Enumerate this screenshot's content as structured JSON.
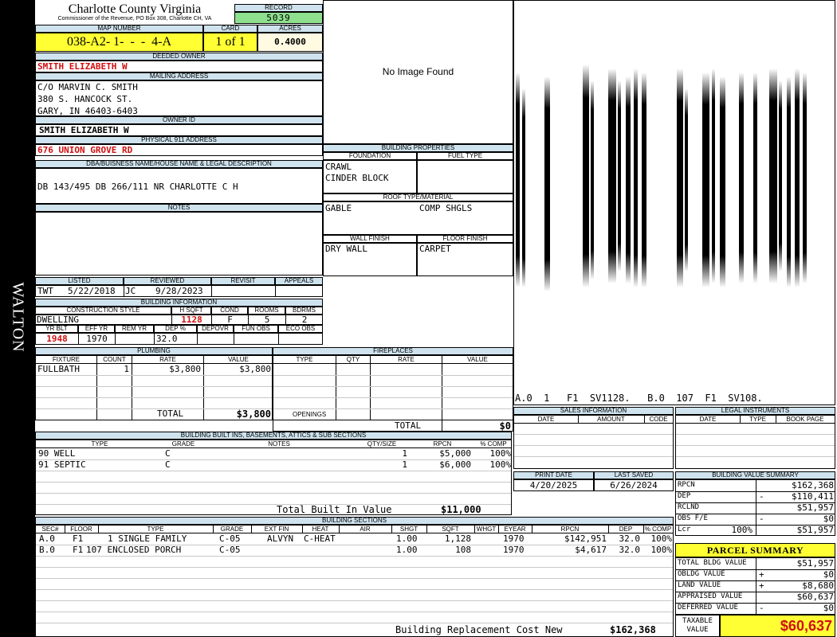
{
  "side_label": "WALTON",
  "header": {
    "county": "Charlotte County Virginia",
    "commissioner": "Commissioner of the Revenue, PO Box 308, Charlotte CH, VA",
    "record_label": "RECORD",
    "record": "5039",
    "map_number_label": "MAP NUMBER",
    "map_number": "038-A2- 1-  -  -  4-A",
    "card_label": "CARD",
    "card": "1 of 1",
    "acres_label": "ACRES",
    "acres": "0.4000"
  },
  "owner": {
    "deeded_owner_label": "DEEDED OWNER",
    "deeded_owner": "SMITH ELIZABETH W",
    "mailing_address_label": "MAILING ADDRESS",
    "mailing_line1": "C/O MARVIN C. SMITH",
    "mailing_line2": "380 S. HANCOCK ST.",
    "mailing_line3": "GARY, IN 46403-6403",
    "owner_id_label": "OWNER ID",
    "owner_id": "SMITH ELIZABETH W",
    "physical_label": "PHYSICAL 911 ADDRESS",
    "physical_address": "676 UNION GROVE RD",
    "legal_label": "DBA/BUISNESS NAME/HOUSE NAME & LEGAL DESCRIPTION",
    "legal_description": "DB 143/495 DB 266/111 NR CHARLOTTE C H",
    "notes_label": "NOTES"
  },
  "image": {
    "placeholder": "No Image Found"
  },
  "sketch": {
    "caption": "A.0  1   F1  SV1128.   B.0  107  F1  SV108."
  },
  "building_properties": {
    "title": "BUILDING PROPERTIES",
    "foundation_label": "FOUNDATION",
    "foundation_1": "CRAWL",
    "foundation_2": "CINDER BLOCK",
    "fuel_label": "FUEL TYPE",
    "fuel": "",
    "roof_label": "ROOF TYPE/MATERIAL",
    "roof_type": "GABLE",
    "roof_material": "COMP SHGLS",
    "wall_label": "WALL FINISH",
    "wall": "DRY WALL",
    "floor_label": "FLOOR FINISH",
    "floor": "CARPET"
  },
  "review": {
    "listed_label": "LISTED",
    "listed_by": "TWT",
    "listed_date": "5/22/2018",
    "reviewed_label": "REVIEWED",
    "reviewed_by": "JC",
    "reviewed_date": "9/28/2023",
    "revisit_label": "REVISIT",
    "appeals_label": "APPEALS"
  },
  "building_info": {
    "title": "BUILDING INFORMATION",
    "style_label": "CONSTRUCTION STYLE",
    "style": "DWELLING",
    "hsqft_label": "H SQFT",
    "hsqft": "1128",
    "cond_label": "COND",
    "cond": "F",
    "rooms_label": "ROOMS",
    "rooms": "5",
    "bdrms_label": "BDRMS",
    "bdrms": "2",
    "yrblt_label": "YR BLT",
    "yrblt": "1948",
    "effyr_label": "EFF YR",
    "effyr": "1970",
    "remyr_label": "REM YR",
    "remyr": "",
    "dep_label": "DEP %",
    "dep": "32.0",
    "depovr_label": "DEPOVR",
    "funobs_label": "FUN OBS",
    "ecoobs_label": "ECO OBS"
  },
  "plumbing": {
    "title": "PLUMBING",
    "headers": [
      "FIXTURE",
      "COUNT",
      "RATE",
      "VALUE"
    ],
    "rows": [
      [
        "FULLBATH",
        "1",
        "$3,800",
        "$3,800"
      ]
    ],
    "total_label": "TOTAL",
    "total": "$3,800"
  },
  "fireplaces": {
    "title": "FIREPLACES",
    "headers": [
      "TYPE",
      "QTY",
      "RATE",
      "VALUE"
    ],
    "openings_label": "OPENINGS",
    "total_label": "TOTAL",
    "total": "$0"
  },
  "built_ins": {
    "title": "BUILDING BUILT INS, BASEMENTS, ATTICS & SUB SECTIONS",
    "headers": [
      "TYPE",
      "GRADE",
      "NOTES",
      "QTY/SIZE",
      "RPCN",
      "% COMP"
    ],
    "rows": [
      [
        "90 WELL",
        "C",
        "",
        "1",
        "$5,000",
        "100%"
      ],
      [
        "91 SEPTIC",
        "C",
        "",
        "1",
        "$6,000",
        "100%"
      ]
    ],
    "total_label": "Total Built In Value",
    "total": "$11,000"
  },
  "sales": {
    "title": "SALES INFORMATION",
    "headers": [
      "DATE",
      "AMOUNT",
      "CODE"
    ]
  },
  "legal_instruments": {
    "title": "LEGAL INSTRUMENTS",
    "headers": [
      "DATE",
      "TYPE",
      "BOOK PAGE"
    ]
  },
  "dates": {
    "print_label": "PRINT DATE",
    "print_date": "4/20/2025",
    "saved_label": "LAST SAVED",
    "saved_date": "6/26/2024"
  },
  "value_summary": {
    "title": "BUILDING VALUE SUMMARY",
    "rows": [
      {
        "label": "RPCN",
        "pct": "",
        "sign": "",
        "value": "$162,368"
      },
      {
        "label": "DEP",
        "pct": "",
        "sign": "-",
        "value": "$110,411"
      },
      {
        "label": "RCLND",
        "pct": "",
        "sign": "",
        "value": "$51,957"
      },
      {
        "label": "OBS F/E",
        "pct": "",
        "sign": "-",
        "value": "$0"
      },
      {
        "label": "Lcr",
        "pct": "100%",
        "sign": "",
        "value": "$51,957"
      }
    ]
  },
  "parcel_summary": {
    "title": "PARCEL SUMMARY",
    "rows": [
      {
        "label": "TOTAL BLDG VALUE",
        "sign": "",
        "value": "$51,957"
      },
      {
        "label": "OBLDG VALUE",
        "sign": "+",
        "value": "$0"
      },
      {
        "label": "LAND VALUE",
        "sign": "+",
        "value": "$8,680"
      },
      {
        "label": "APPRAISED VALUE",
        "sign": "",
        "value": "$60,637"
      },
      {
        "label": "DEFERRED VALUE",
        "sign": "-",
        "value": "$0"
      }
    ],
    "taxable_label_1": "TAXABLE",
    "taxable_label_2": "VALUE",
    "taxable_value": "$60,637"
  },
  "sections": {
    "title": "BUILDING SECTIONS",
    "headers": [
      "SEC#",
      "FLOOR",
      "TYPE",
      "GRADE",
      "EXT FIN",
      "HEAT",
      "AIR",
      "SHGT",
      "SQFT",
      "WHGT",
      "EYEAR",
      "RPCN",
      "DEP",
      "% COMP"
    ],
    "rows": [
      [
        "A.0",
        "F1",
        "1 SINGLE FAMILY",
        "C-05",
        "ALVYN",
        "C-HEAT",
        "",
        "1.00",
        "1,128",
        "",
        "1970",
        "$142,951",
        "32.0",
        "100%"
      ],
      [
        "B.0",
        "F1",
        "107 ENCLOSED PORCH",
        "C-05",
        "",
        "",
        "",
        "1.00",
        "108",
        "",
        "1970",
        "$4,617",
        "32.0",
        "100%"
      ]
    ],
    "replacement_label": "Building Replacement Cost New",
    "replacement_value": "$162,368"
  }
}
